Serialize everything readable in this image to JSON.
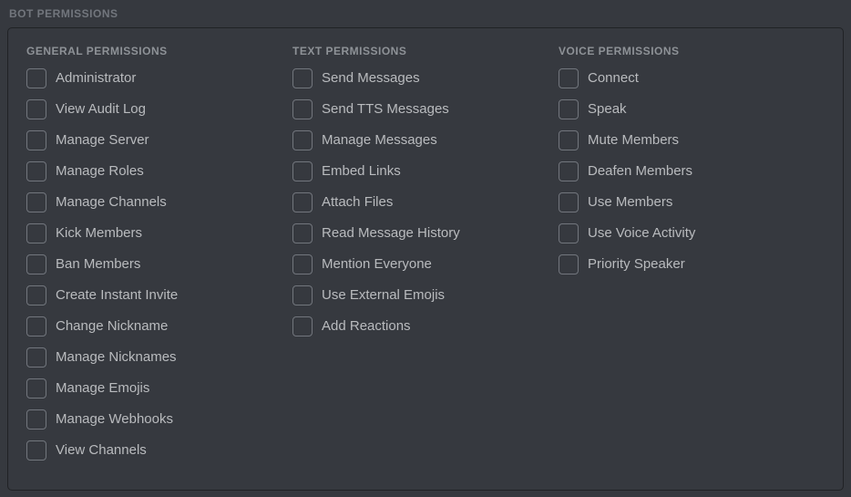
{
  "section_title": "Bot Permissions",
  "columns": {
    "general": {
      "title": "General Permissions",
      "items": [
        "Administrator",
        "View Audit Log",
        "Manage Server",
        "Manage Roles",
        "Manage Channels",
        "Kick Members",
        "Ban Members",
        "Create Instant Invite",
        "Change Nickname",
        "Manage Nicknames",
        "Manage Emojis",
        "Manage Webhooks",
        "View Channels"
      ]
    },
    "text": {
      "title": "Text Permissions",
      "items": [
        "Send Messages",
        "Send TTS Messages",
        "Manage Messages",
        "Embed Links",
        "Attach Files",
        "Read Message History",
        "Mention Everyone",
        "Use External Emojis",
        "Add Reactions"
      ]
    },
    "voice": {
      "title": "Voice Permissions",
      "items": [
        "Connect",
        "Speak",
        "Mute Members",
        "Deafen Members",
        "Use Members",
        "Use Voice Activity",
        "Priority Speaker"
      ]
    }
  }
}
